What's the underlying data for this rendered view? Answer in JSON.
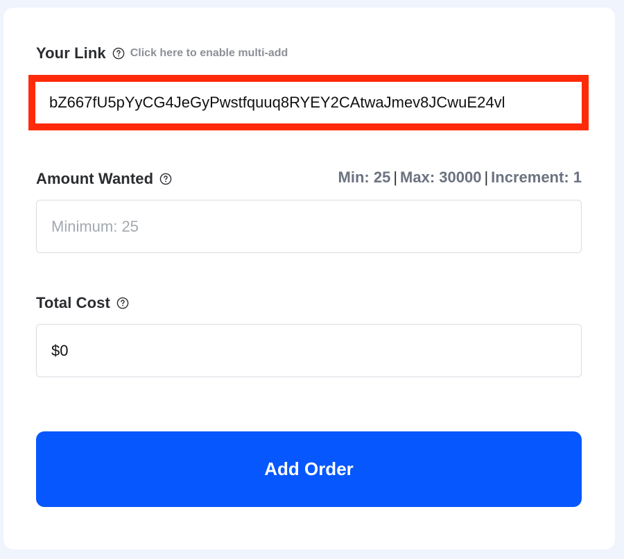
{
  "link_section": {
    "label": "Your Link",
    "multi_add_text": "Click here to enable multi-add",
    "value": "bZ667fU5pYyCG4JeGyPwstfquuq8RYEY2CAtwaJmev8JCwuE24vl",
    "highlight_color": "#ff2a0a"
  },
  "amount_section": {
    "label": "Amount Wanted",
    "min_text": "Min: 25",
    "max_text": "Max: 30000",
    "increment_text": "Increment: 1",
    "separator": "|",
    "placeholder": "Minimum: 25",
    "value": ""
  },
  "total_section": {
    "label": "Total Cost",
    "value": "$0"
  },
  "actions": {
    "add_order_label": "Add Order",
    "button_color": "#0657fd"
  },
  "icons": {
    "help": "question-circle-icon"
  }
}
